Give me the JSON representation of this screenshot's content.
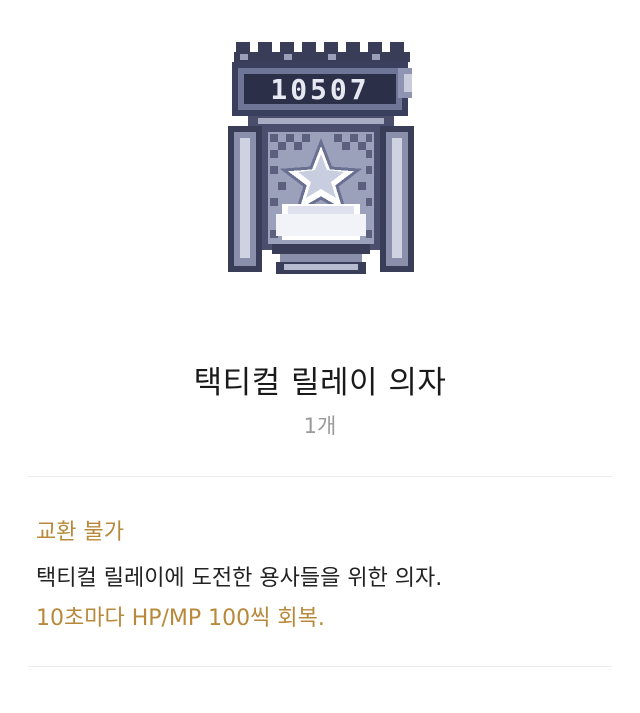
{
  "item": {
    "name": "택티컬 릴레이 의자",
    "count": "1개",
    "sign_number": "10507",
    "trade_status": "교환 불가",
    "description": "택티컬 릴레이에 도전한 용사들을 위한 의자.",
    "effect": "10초마다 HP/MP 100씩 회복.",
    "icon": "star-chair-icon"
  },
  "colors": {
    "accent": "#b8893a",
    "text": "#222222",
    "muted": "#9a9a9a",
    "divider": "#ececec"
  }
}
